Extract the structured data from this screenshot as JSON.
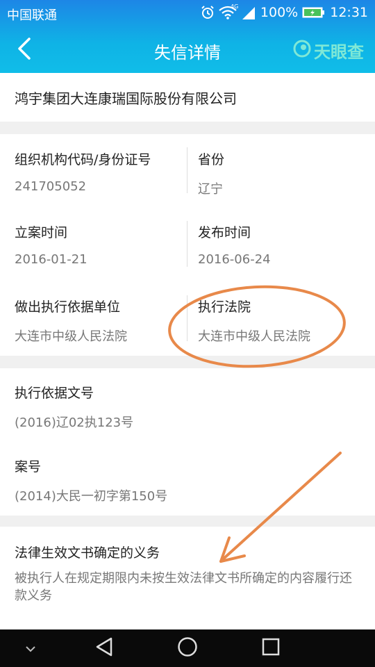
{
  "status_bar": {
    "carrier": "中国联通",
    "network": "4G",
    "battery": "100%",
    "time": "12:31"
  },
  "header": {
    "title": "失信详情",
    "brand": "天眼查"
  },
  "company": {
    "name": "鸿宇集团大连康瑞国际股份有限公司"
  },
  "fields": {
    "org_code_label": "组织机构代码/身份证号",
    "org_code_value": "241705052",
    "province_label": "省份",
    "province_value": "辽宁",
    "filing_date_label": "立案时间",
    "filing_date_value": "2016-01-21",
    "publish_date_label": "发布时间",
    "publish_date_value": "2016-06-24",
    "basis_unit_label": "做出执行依据单位",
    "basis_unit_value": "大连市中级人民法院",
    "court_label": "执行法院",
    "court_value": "大连市中级人民法院",
    "basis_doc_label": "执行依据文号",
    "basis_doc_value": "(2016)辽02执123号",
    "case_no_label": "案号",
    "case_no_value": "(2014)大民一初字第150号",
    "duty_label": "法律生效文书确定的义务",
    "duty_value": "被执行人在规定期限内未按生效法律文书所确定的内容履行还款义务"
  },
  "annotation": {
    "color": "#e8894a"
  },
  "nav_icons": [
    "chevron-down-icon",
    "back-triangle-icon",
    "home-circle-icon",
    "recents-square-icon"
  ],
  "colors": {
    "header_top": "#1d86e6",
    "header_bottom": "#10bde8",
    "brand": "#7fe8d6"
  }
}
